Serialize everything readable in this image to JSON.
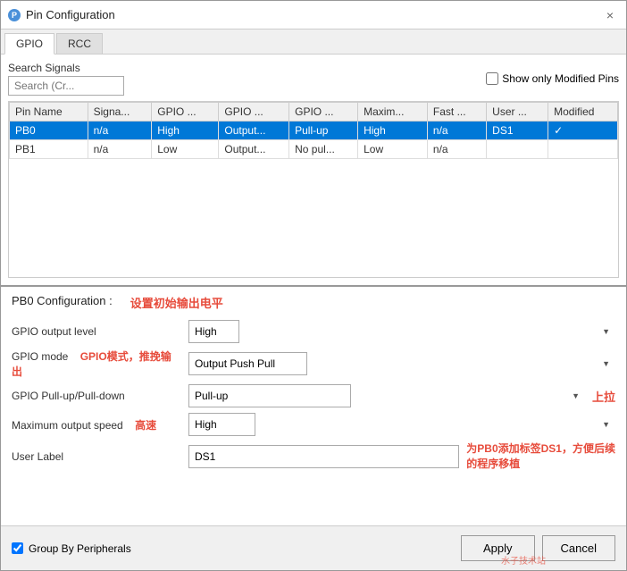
{
  "window": {
    "title": "Pin Configuration",
    "icon_char": "P",
    "close_label": "×"
  },
  "tabs": [
    {
      "label": "GPIO",
      "active": true
    },
    {
      "label": "RCC",
      "active": false
    }
  ],
  "search": {
    "label": "Search Signals",
    "placeholder": "Search (Cr...",
    "show_modified_label": "Show only Modified Pins"
  },
  "table": {
    "columns": [
      "Pin Name",
      "Signa...",
      "GPIO ...",
      "GPIO ...",
      "GPIO ...",
      "Maxim...",
      "Fast ...",
      "User ...",
      "Modified"
    ],
    "rows": [
      {
        "pin_name": "PB0",
        "signal": "n/a",
        "gpio_col1": "High",
        "gpio_col2": "Output...",
        "gpio_col3": "Pull-up",
        "max": "High",
        "fast": "n/a",
        "user": "DS1",
        "modified": "✓",
        "selected": true
      },
      {
        "pin_name": "PB1",
        "signal": "n/a",
        "gpio_col1": "Low",
        "gpio_col2": "Output...",
        "gpio_col3": "No pul...",
        "max": "Low",
        "fast": "n/a",
        "user": "",
        "modified": "",
        "selected": false
      }
    ]
  },
  "config": {
    "title": "PB0 Configuration :",
    "annotation_top": "设置初始输出电平",
    "fields": [
      {
        "label": "GPIO output level",
        "type": "select",
        "value": "High",
        "annotation": ""
      },
      {
        "label": "GPIO mode",
        "type": "select",
        "value": "Output Push Pull",
        "annotation": "GPIO模式，推挽输出"
      },
      {
        "label": "GPIO Pull-up/Pull-down",
        "type": "select",
        "value": "Pull-up",
        "annotation": "上拉"
      },
      {
        "label": "Maximum output speed",
        "type": "select",
        "value": "High",
        "annotation": "高速"
      },
      {
        "label": "User Label",
        "type": "input",
        "value": "DS1",
        "annotation": "为PB0添加标签DS1，方便后续\n的程序移植"
      }
    ]
  },
  "bottom": {
    "group_label": "Group By Peripherals",
    "apply_label": "Apply",
    "cancel_label": "Cancel"
  }
}
